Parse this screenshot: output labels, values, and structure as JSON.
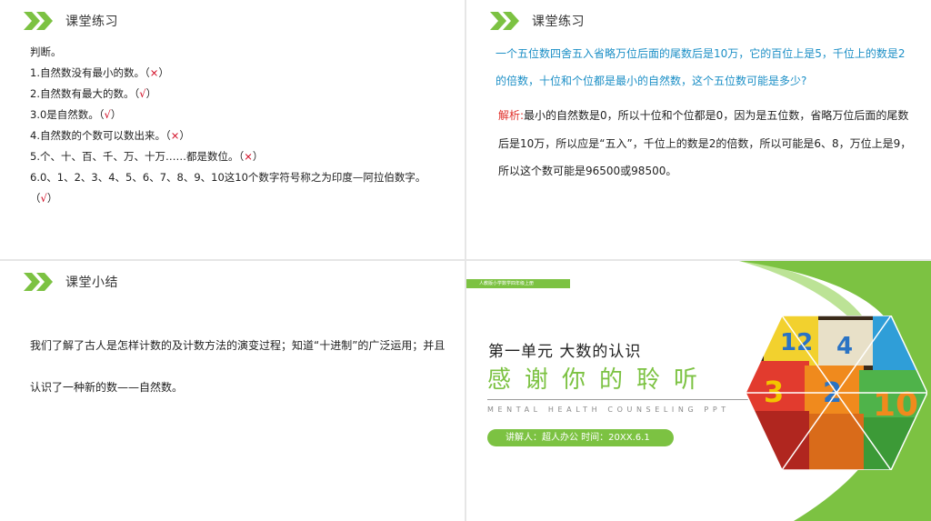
{
  "slide1": {
    "title": "课堂练习",
    "intro": "判断。",
    "items": [
      {
        "text": "1.自然数没有最小的数。（",
        "mark": "×",
        "close": "）"
      },
      {
        "text": "2.自然数有最大的数。（",
        "mark": "√",
        "close": "）"
      },
      {
        "text": "3.0是自然数。（",
        "mark": "√",
        "close": "）"
      },
      {
        "text": "4.自然数的个数可以数出来。（",
        "mark": "×",
        "close": "）"
      },
      {
        "text": "5.个、十、百、千、万、十万……都是数位。（",
        "mark": "×",
        "close": "）"
      },
      {
        "text": "6.0、1、2、3、4、5、6、7、8、9、10这10个数字符号称之为印度—阿拉伯数字。（",
        "mark": "√",
        "close": "）"
      }
    ]
  },
  "slide2": {
    "title": "课堂练习",
    "question": "一个五位数四舍五入省略万位后面的尾数后是10万，它的百位上是5，千位上的数是2的倍数，十位和个位都是最小的自然数，这个五位数可能是多少?",
    "answer_label": "解析:",
    "answer": "最小的自然数是0，所以十位和个位都是0，因为是五位数，省略万位后面的尾数后是10万，所以应是“五入”，千位上的数是2的倍数，所以可能是6、8，万位上是9，所以这个数可能是96500或98500。"
  },
  "slide3": {
    "title": "课堂小结",
    "body": "我们了解了古人是怎样计数的及计数方法的演变过程；知道“十进制”的广泛运用；并且认识了一种新的数——自然数。"
  },
  "slide4": {
    "ribbon": "人教版小学数学四年级上册",
    "unit_title": "第一单元 大数的认识",
    "thanks": "感谢你的聆听",
    "subtitle_en": "MENTAL HEALTH COUNSELING PPT",
    "presenter": "讲解人：超人办公 时间：20XX.6.1",
    "block_numbers": [
      "12",
      "4",
      "3",
      "2",
      "10"
    ]
  },
  "colors": {
    "accent_green": "#7cc242",
    "question_blue": "#1c8fc6",
    "mark_red": "#d0021b"
  }
}
